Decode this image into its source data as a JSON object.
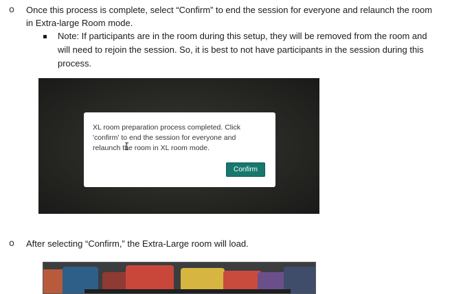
{
  "items": [
    {
      "bullet": "o",
      "line1": "Once this process is complete, select “Confirm” to end the session for everyone and relaunch the room",
      "line2": "in Extra-large Room mode."
    },
    {
      "bullet": "o",
      "line1": "After selecting “Confirm,” the Extra-Large room will load."
    }
  ],
  "note": {
    "line1": "Note: If participants are in the room during this setup, they will be removed from the room and",
    "line2": "will need to rejoin the session. So, it is best to not have participants in the session during this",
    "line3": "process."
  },
  "dialog": {
    "line1": "XL room preparation process completed. Click",
    "line2": "'confirm' to end the session for everyone and",
    "line3": "relaunch the room in XL room mode.",
    "confirm_label": "Confirm",
    "accent": "#17786d"
  }
}
